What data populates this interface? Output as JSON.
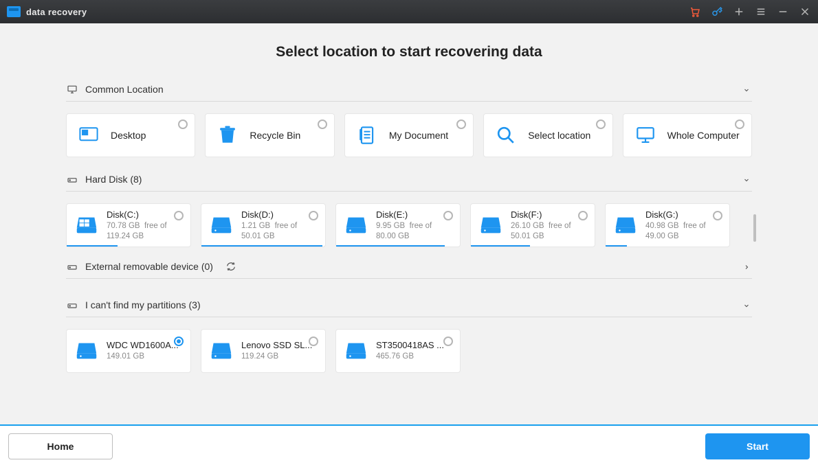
{
  "app_title": "data recovery",
  "heading": "Select location to start recovering data",
  "sections": {
    "common": {
      "title": "Common Location"
    },
    "hard": {
      "title": "Hard Disk (8)"
    },
    "ext": {
      "title": "External removable device (0)"
    },
    "lost": {
      "title": "I can't find my partitions (3)"
    }
  },
  "common_items": [
    {
      "label": "Desktop"
    },
    {
      "label": "Recycle Bin"
    },
    {
      "label": "My Document"
    },
    {
      "label": "Select location"
    },
    {
      "label": "Whole Computer"
    }
  ],
  "disks": [
    {
      "name": "Disk(C:)",
      "free": "70.78 GB",
      "total": "119.24 GB",
      "pct": 41
    },
    {
      "name": "Disk(D:)",
      "free": "1.21 GB",
      "total": "50.01 GB",
      "pct": 98
    },
    {
      "name": "Disk(E:)",
      "free": "9.95 GB",
      "total": "80.00 GB",
      "pct": 88
    },
    {
      "name": "Disk(F:)",
      "free": "26.10 GB",
      "total": "50.01 GB",
      "pct": 48
    },
    {
      "name": "Disk(G:)",
      "free": "40.98 GB",
      "total": "49.00 GB",
      "pct": 17
    }
  ],
  "lost": [
    {
      "name": "WDC WD1600A...",
      "size": "149.01 GB",
      "selected": true
    },
    {
      "name": "Lenovo SSD SL...",
      "size": "119.24 GB",
      "selected": false
    },
    {
      "name": "ST3500418AS ...",
      "size": "465.76 GB",
      "selected": false
    }
  ],
  "buttons": {
    "home": "Home",
    "start": "Start"
  },
  "labels": {
    "free_of": "free of"
  }
}
